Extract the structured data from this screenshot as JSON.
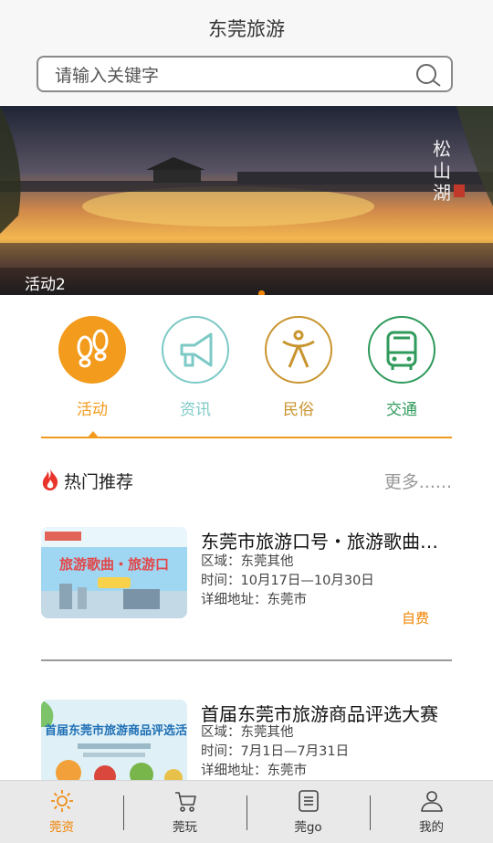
{
  "header": {
    "title": "东莞旅游",
    "search_placeholder": "请输入关键字"
  },
  "banner": {
    "caption": "活动2",
    "image_text": "松山湖"
  },
  "categories": [
    {
      "label": "活动",
      "icon": "footprints-icon",
      "color": "#f39b1c"
    },
    {
      "label": "资讯",
      "icon": "megaphone-icon",
      "color": "#7cc9c6"
    },
    {
      "label": "民俗",
      "icon": "folk-figure-icon",
      "color": "#c8952f"
    },
    {
      "label": "交通",
      "icon": "bus-icon",
      "color": "#2f9a5b"
    }
  ],
  "hot": {
    "title": "热门推荐",
    "more": "更多......"
  },
  "items": [
    {
      "title": "东莞市旅游口号・旅游歌曲…",
      "region": "区域：东莞其他",
      "time": "时间：10月17日—10月30日",
      "address": "详细地址：东莞市",
      "fee": "自费",
      "thumb_text": "旅游歌曲・旅游口"
    },
    {
      "title": "首届东莞市旅游商品评选大赛",
      "region": "区域：东莞其他",
      "time": "时间：7月1日—7月31日",
      "address": "详细地址：东莞市",
      "thumb_text": "首届东莞市旅游商品评选活"
    }
  ],
  "tabs": [
    {
      "label": "莞资",
      "icon": "sun-icon",
      "active": true
    },
    {
      "label": "莞玩",
      "icon": "cart-icon",
      "active": false
    },
    {
      "label": "莞go",
      "icon": "list-icon",
      "active": false
    },
    {
      "label": "我的",
      "icon": "person-icon",
      "active": false
    }
  ],
  "colors": {
    "accent": "#f19a1e",
    "active_tab": "#f08300"
  }
}
